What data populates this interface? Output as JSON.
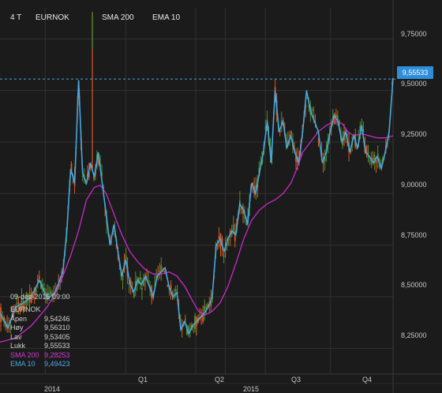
{
  "header": {
    "timeframe": "4 T",
    "symbol": "EURNOK",
    "indicator_1": "SMA 200",
    "indicator_2": "EMA 10"
  },
  "colors": {
    "background": "#1b1b1b",
    "grid": "#323232",
    "up_candle": "#4f8f2f",
    "down_candle": "#d85a24",
    "sma200": "#c72bc9",
    "ema10": "#46a8e0",
    "price_badge": "#2f8ed8"
  },
  "last_price_label": "9,55533",
  "info_panel": {
    "datetime": "09-des-2015 09:00",
    "symbol": "EURNOK",
    "rows": [
      {
        "label": "Åpen",
        "value": "9,54246"
      },
      {
        "label": "Høy",
        "value": "9,56310"
      },
      {
        "label": "Lav",
        "value": "9,53405"
      },
      {
        "label": "Lukk",
        "value": "9,55533"
      },
      {
        "label": "SMA 200",
        "value": "9,28253"
      },
      {
        "label": "EMA 10",
        "value": "9,49423"
      }
    ]
  },
  "chart_data": {
    "type": "line",
    "title": "EURNOK",
    "y_ticks": [
      "9,75000",
      "9,50000",
      "9,25000",
      "9,00000",
      "8,75000",
      "8,50000",
      "8,25000"
    ],
    "y_tick_values": [
      9.75,
      9.5,
      9.25,
      9.0,
      8.75,
      8.5,
      8.25
    ],
    "ylim": [
      8.125,
      9.9
    ],
    "x_ticks_top": [
      "Q1",
      "Q2",
      "Q3",
      "Q4"
    ],
    "x_ticks_bottom": [
      "2014",
      "2015"
    ],
    "xlim": [
      0,
      100
    ],
    "x_tick_positions": {
      "Q1": 32,
      "Q2": 49.8,
      "Q3": 67.5,
      "Q4": 84,
      "2014": 11.5,
      "2015": 57.3
    },
    "last_price": 9.55533,
    "grid": true,
    "series": [
      {
        "name": "EMA 10",
        "x": [
          0,
          2,
          4,
          6,
          8,
          10,
          12,
          14,
          16,
          17,
          18,
          19,
          20,
          21,
          22,
          23,
          24,
          25,
          26,
          27,
          28,
          29,
          30,
          31,
          32,
          33,
          34,
          35,
          36,
          37,
          38,
          39,
          40,
          41,
          42,
          43,
          44,
          45,
          46,
          47,
          48,
          49,
          50,
          51,
          52,
          53,
          54,
          55,
          56,
          57,
          58,
          59,
          60,
          61,
          62,
          63,
          64,
          65,
          66,
          67,
          68,
          69,
          70,
          71,
          72,
          73,
          74,
          75,
          76,
          77,
          78,
          79,
          80,
          81,
          82,
          83,
          84,
          85,
          86,
          87,
          88,
          89,
          90,
          91,
          92,
          93,
          94,
          95,
          96,
          97,
          98,
          99,
          100
        ],
        "values": [
          8.42,
          8.35,
          8.45,
          8.47,
          8.5,
          8.58,
          8.49,
          8.52,
          8.62,
          8.82,
          9.12,
          9.05,
          9.55,
          9.1,
          9.05,
          9.15,
          9.08,
          9.2,
          9.05,
          8.9,
          8.75,
          8.85,
          8.72,
          8.6,
          8.68,
          8.57,
          8.52,
          8.58,
          8.56,
          8.6,
          8.55,
          8.5,
          8.6,
          8.62,
          8.64,
          8.55,
          8.5,
          8.52,
          8.34,
          8.38,
          8.32,
          8.36,
          8.38,
          8.4,
          8.42,
          8.45,
          8.5,
          8.75,
          8.78,
          8.72,
          8.78,
          8.82,
          8.8,
          8.95,
          8.92,
          8.85,
          9.05,
          9.0,
          9.1,
          9.2,
          9.35,
          9.15,
          9.5,
          9.3,
          9.35,
          9.22,
          9.28,
          9.2,
          9.15,
          9.3,
          9.5,
          9.4,
          9.35,
          9.3,
          9.15,
          9.2,
          9.3,
          9.38,
          9.35,
          9.25,
          9.3,
          9.2,
          9.28,
          9.22,
          9.33,
          9.2,
          9.18,
          9.15,
          9.18,
          9.12,
          9.2,
          9.3,
          9.56
        ]
      },
      {
        "name": "SMA 200",
        "x": [
          0,
          4,
          8,
          12,
          15,
          18,
          20,
          22,
          24,
          25.5,
          27,
          29,
          31,
          33,
          35,
          37,
          39,
          41,
          43,
          45,
          47,
          49,
          50.5,
          52,
          54,
          56,
          58,
          60,
          62,
          64,
          66,
          68,
          70,
          72,
          74,
          75.5,
          77,
          79,
          81,
          83,
          85,
          87,
          88.5,
          90,
          92,
          94,
          96,
          98,
          100
        ],
        "values": [
          8.28,
          8.3,
          8.36,
          8.45,
          8.55,
          8.7,
          8.82,
          8.97,
          9.03,
          9.04,
          9.0,
          8.9,
          8.8,
          8.72,
          8.67,
          8.63,
          8.61,
          8.61,
          8.62,
          8.6,
          8.55,
          8.48,
          8.43,
          8.41,
          8.43,
          8.47,
          8.55,
          8.66,
          8.78,
          8.87,
          8.92,
          8.95,
          8.97,
          9.0,
          9.05,
          9.12,
          9.2,
          9.25,
          9.3,
          9.33,
          9.35,
          9.34,
          9.3,
          9.28,
          9.29,
          9.28,
          9.27,
          9.27,
          9.28
        ]
      }
    ]
  }
}
